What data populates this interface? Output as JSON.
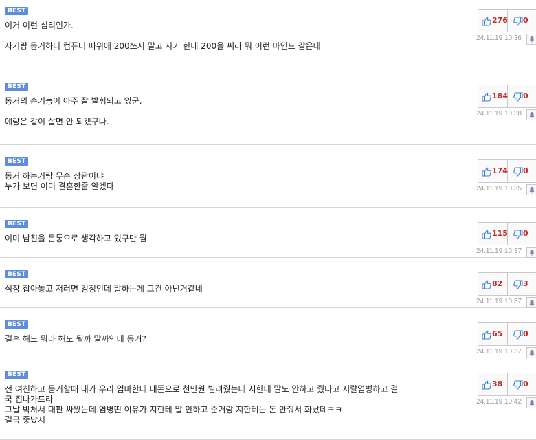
{
  "badge_label": "BEST",
  "comments": [
    {
      "lines": [
        "이거 이런 심리인가.",
        "",
        "자기랑 동거하니 컴퓨터 따위에 200쓰지 말고 자기 한테 200을 써라 뭐 이런 마인드 같은데"
      ],
      "likes": "276",
      "dislikes": "0",
      "date": "24.11.19 10:36"
    },
    {
      "lines": [
        "동거의 순기능이 아주 잘 발휘되고 있군.",
        "",
        "얘랑은 같이 살면 안 되겠구나."
      ],
      "likes": "184",
      "dislikes": "0",
      "date": "24.11.19 10:38"
    },
    {
      "lines": [
        "동거 하는거랑 무슨 상관이냐",
        "누가 보면 이미 결혼한줄 알겠다"
      ],
      "likes": "174",
      "dislikes": "0",
      "date": "24.11.19 10:35"
    },
    {
      "lines": [
        "이미 남친을 돈통으로 생각하고 있구만 뭘"
      ],
      "likes": "115",
      "dislikes": "0",
      "date": "24.11.19 10:37"
    },
    {
      "lines": [
        "식장 잡아놓고 저러면 킹정인데 말하는게 그건 아닌거같네"
      ],
      "likes": "82",
      "dislikes": "3",
      "date": "24.11.19 10:37"
    },
    {
      "lines": [
        "결혼 해도 뭐라 해도 될까 말까인데 동거?"
      ],
      "likes": "65",
      "dislikes": "0",
      "date": "24.11.19 10:37"
    },
    {
      "lines": [
        "전 여친하고 동거할때 내가 우리 엄마한테 내돈으로 천만원 빌려줬는데 지한테 말도 안하고 줬다고 지랄염병하고 결",
        "국 집나가드라",
        "그날 박처서 대판 싸웠는데 염병떤 이유가 지한테 말 안하고 준거랑 지한테는 돈 안줘서 화났데ㅋㅋ",
        "결국 좋났지"
      ],
      "likes": "38",
      "dislikes": "0",
      "date": "24.11.19 10:42"
    }
  ],
  "colors": {
    "badge": "#5b8de0",
    "count": "#c62828",
    "thumb": "#3d7fd6"
  },
  "icons": {
    "like": "thumbs-up-icon",
    "dislike": "thumbs-down-icon",
    "report": "report-bell-icon"
  }
}
